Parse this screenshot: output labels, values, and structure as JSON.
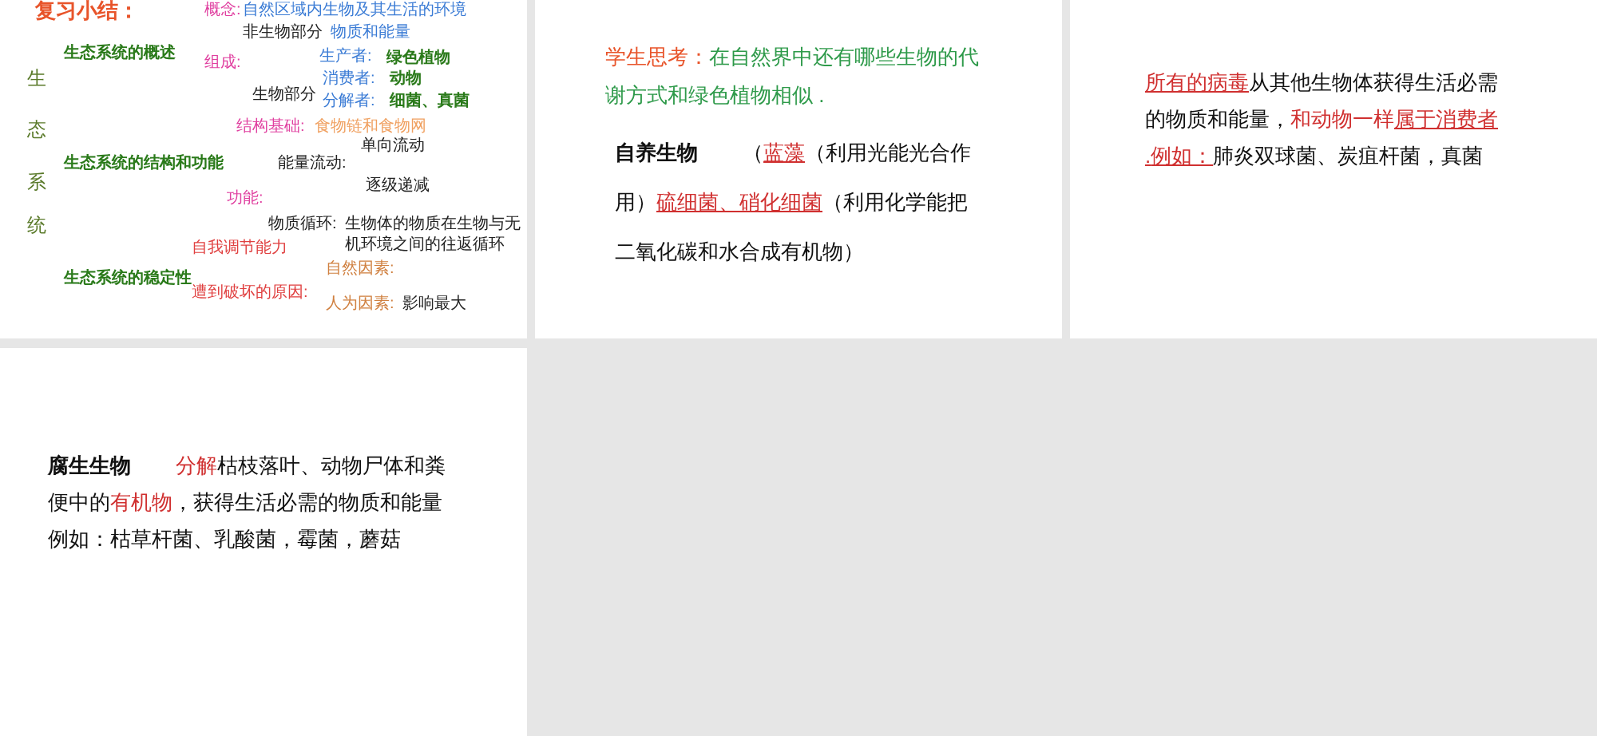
{
  "slides": [
    {
      "kind": "mindmap",
      "items": [
        {
          "kind": "title",
          "text": "复习小结：",
          "color": "#e8542a"
        },
        {
          "kind": "text",
          "text": "概念:",
          "color": "#e040a0"
        },
        {
          "kind": "text",
          "text": "自然区域内生物及其生活的环境",
          "color": "#3a7bd5"
        },
        {
          "kind": "text",
          "text": "非生物部分",
          "color": "#222222"
        },
        {
          "kind": "text",
          "text": "物质和能量",
          "color": "#3a7bd5"
        },
        {
          "kind": "heading",
          "text": "生态系统的概述",
          "color": "#2a7a1a"
        },
        {
          "kind": "text",
          "text": "组成:",
          "color": "#e040a0"
        },
        {
          "kind": "text",
          "text": "生产者:",
          "color": "#3a7bd5"
        },
        {
          "kind": "heading",
          "text": "绿色植物",
          "color": "#2a7a1a"
        },
        {
          "kind": "text",
          "text": "消费者:",
          "color": "#3a7bd5"
        },
        {
          "kind": "heading",
          "text": "动物",
          "color": "#2a7a1a"
        },
        {
          "kind": "text",
          "text": "生物部分",
          "color": "#222222"
        },
        {
          "kind": "text",
          "text": "分解者:",
          "color": "#3a7bd5"
        },
        {
          "kind": "heading",
          "text": "细菌、真菌",
          "color": "#2a7a1a"
        },
        {
          "kind": "vertical",
          "text": "生",
          "color": "#5a7a2a"
        },
        {
          "kind": "vertical",
          "text": "态",
          "color": "#5a7a2a"
        },
        {
          "kind": "vertical",
          "text": "系",
          "color": "#5a7a2a"
        },
        {
          "kind": "vertical",
          "text": "统",
          "color": "#5a7a2a"
        },
        {
          "kind": "text",
          "text": "结构基础:",
          "color": "#e040a0"
        },
        {
          "kind": "text",
          "text": "食物链和食物网",
          "color": "#f0a060"
        },
        {
          "kind": "text",
          "text": "单向流动",
          "color": "#222222"
        },
        {
          "kind": "heading",
          "text": "生态系统的结构和功能",
          "color": "#2a7a1a"
        },
        {
          "kind": "text",
          "text": "能量流动:",
          "color": "#222222"
        },
        {
          "kind": "text",
          "text": "逐级递减",
          "color": "#222222"
        },
        {
          "kind": "text",
          "text": "功能:",
          "color": "#e040a0"
        },
        {
          "kind": "text",
          "text": "自我调节能力",
          "color": "#e04040"
        },
        {
          "kind": "text",
          "text": "物质循环:",
          "color": "#222222"
        },
        {
          "kind": "text",
          "text": "生物体的物质在生物与无机环境之间的往返循环",
          "color": "#222222"
        },
        {
          "kind": "text",
          "text": "自然因素:",
          "color": "#d08040"
        },
        {
          "kind": "heading",
          "text": "生态系统的稳定性",
          "color": "#2a7a1a"
        },
        {
          "kind": "text",
          "text": "遭到破坏的原因:",
          "color": "#e04040"
        },
        {
          "kind": "text",
          "text": "人为因素:",
          "color": "#d08040"
        },
        {
          "kind": "text",
          "text": "影响最大",
          "color": "#222222"
        }
      ]
    },
    {
      "kind": "question",
      "paragraphs": [
        [
          {
            "kind": "label",
            "text": "学生思考："
          },
          {
            "kind": "prompt",
            "text": "在自然界中还有哪些生物的代谢方式和绿色植物相似 ."
          }
        ],
        [
          {
            "kind": "term",
            "text": "自养生物"
          },
          {
            "kind": "plain",
            "text": "（"
          },
          {
            "kind": "key",
            "text": "蓝藻"
          },
          {
            "kind": "plain",
            "text": "（利用光能光合作用）"
          },
          {
            "kind": "key",
            "text": "硫细菌、硝化细菌"
          },
          {
            "kind": "plain",
            "text": "（利用化学能把二氧化碳和水合成有机物）"
          }
        ]
      ]
    },
    {
      "kind": "text",
      "paragraphs": [
        [
          {
            "kind": "key",
            "text": "所有的病毒"
          },
          {
            "kind": "plain",
            "text": "从其他生物体获得生活必需的物质和能量，"
          },
          {
            "kind": "emphasis",
            "text": "和动物一样"
          },
          {
            "kind": "key",
            "text": "属于消费者 ."
          },
          {
            "kind": "key",
            "text": "例如："
          },
          {
            "kind": "plain",
            "text": "肺炎双球菌、炭疽杆菌，真菌"
          }
        ]
      ]
    },
    {
      "kind": "text",
      "paragraphs": [
        [
          {
            "kind": "term",
            "text": "腐生生物"
          },
          {
            "kind": "emphasis",
            "text": "分解"
          },
          {
            "kind": "plain",
            "text": "枯枝落叶、动物尸体和粪便中的"
          },
          {
            "kind": "emphasis",
            "text": "有机物"
          },
          {
            "kind": "plain",
            "text": "，获得生活必需的物质和能量"
          }
        ],
        [
          {
            "kind": "plain",
            "text": "例如：枯草杆菌、乳酸菌，霉菌，蘑菇"
          }
        ]
      ]
    }
  ]
}
